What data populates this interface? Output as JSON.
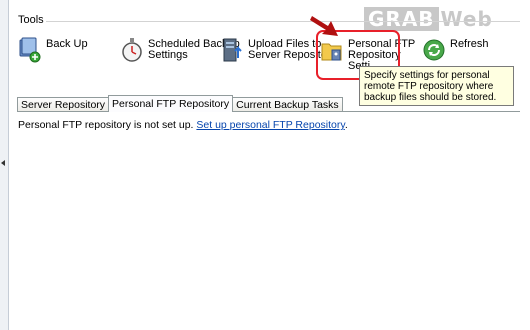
{
  "watermark": {
    "part1": "GRAB",
    "part2": "Web"
  },
  "tools": {
    "title": "Tools",
    "items": [
      {
        "id": "back-up",
        "label": "Back Up",
        "icon": "backup-icon"
      },
      {
        "id": "scheduled",
        "label": "Scheduled Backup\nSettings",
        "icon": "stopwatch-icon"
      },
      {
        "id": "upload",
        "label": "Upload Files to\nServer Repository",
        "icon": "server-upload-icon"
      },
      {
        "id": "ftp",
        "label": "Personal FTP\nRepository\nSetti",
        "icon": "ftp-folder-icon"
      },
      {
        "id": "refresh",
        "label": "Refresh",
        "icon": "refresh-icon"
      }
    ]
  },
  "tooltip": {
    "text": "Specify settings for personal remote FTP repository where backup files should be stored."
  },
  "tabs": [
    {
      "label": "Server Repository",
      "active": false
    },
    {
      "label": "Personal FTP Repository",
      "active": true
    },
    {
      "label": "Current Backup Tasks",
      "active": false
    }
  ],
  "message": {
    "text": "Personal FTP repository is not set up.",
    "link": "Set up personal FTP Repository",
    "suffix": "."
  },
  "colors": {
    "highlight": "#e8202a",
    "arrow": "#b01010",
    "tooltip_bg": "#ffffe1",
    "link": "#0645ad"
  }
}
